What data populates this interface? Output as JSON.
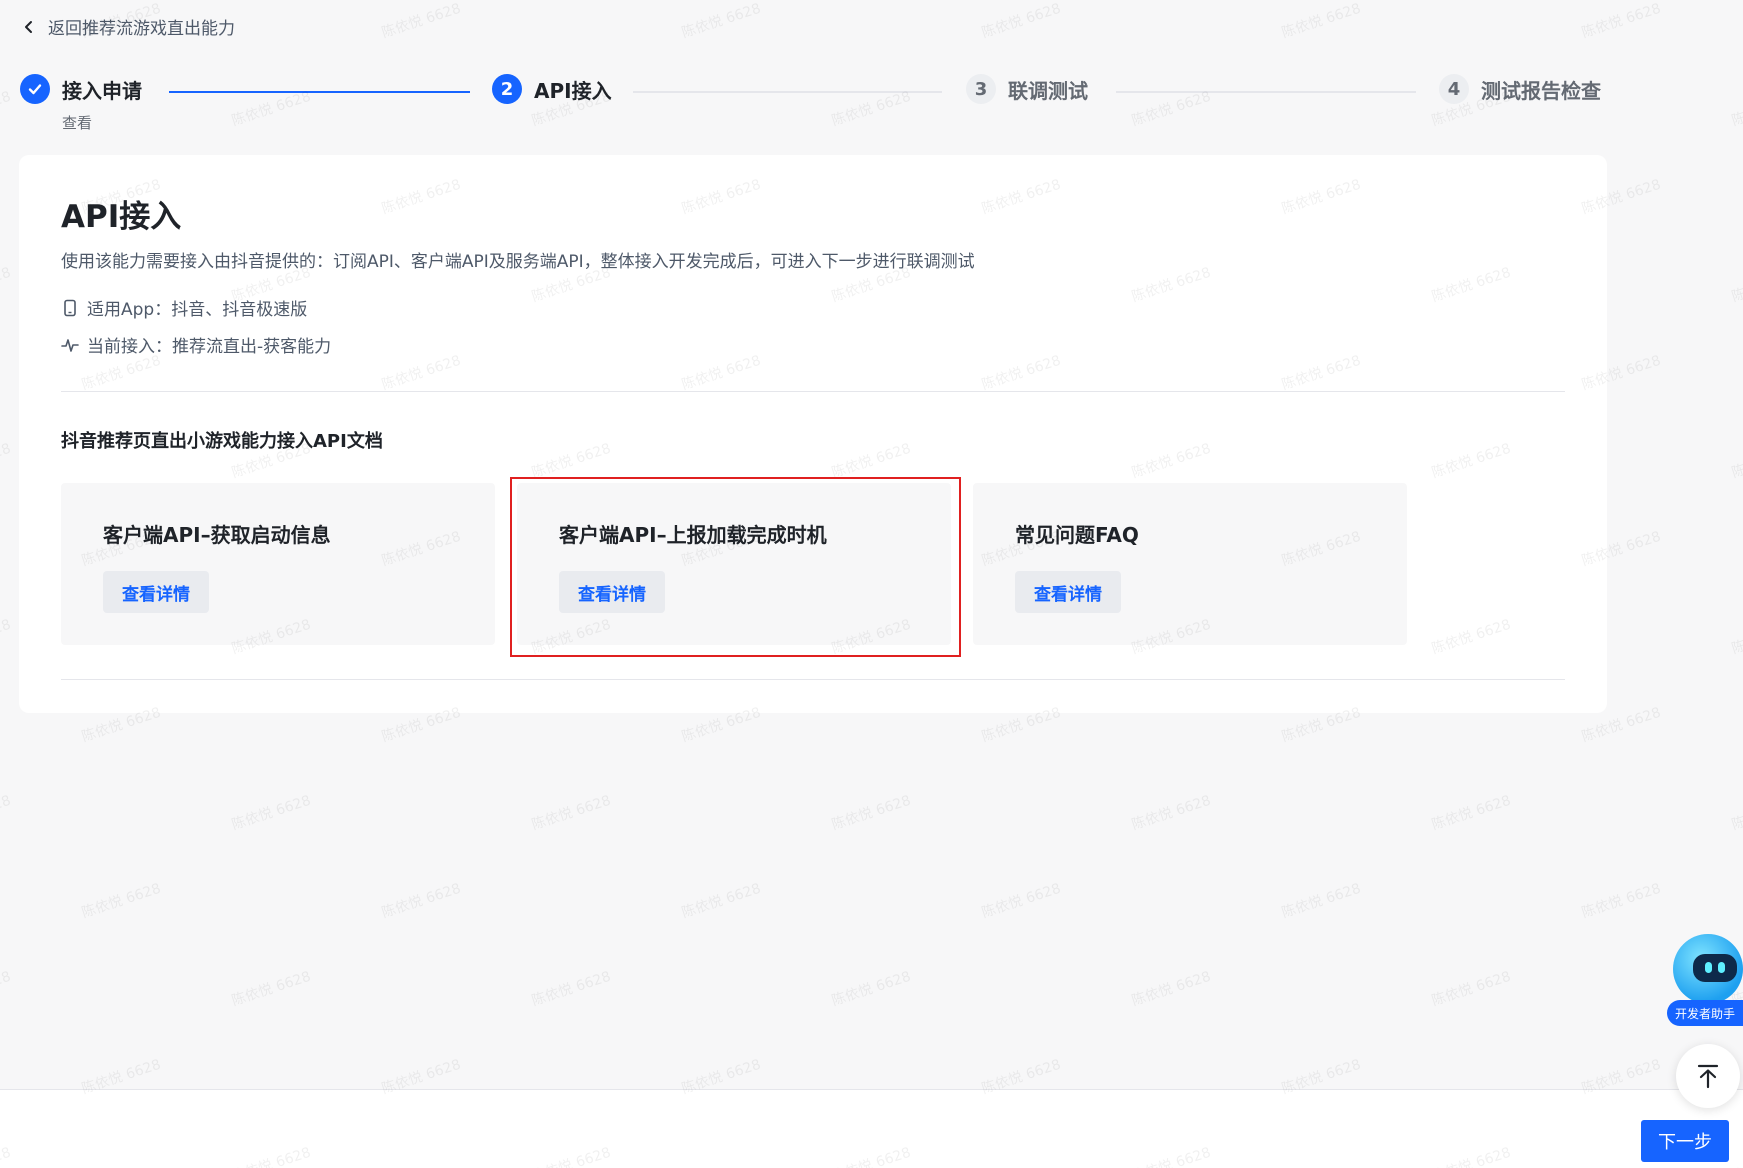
{
  "back": {
    "label": "返回推荐流游戏直出能力"
  },
  "steps": [
    {
      "number": "",
      "label": "接入申请",
      "sub": "查看",
      "status": "done"
    },
    {
      "number": "2",
      "label": "API接入",
      "status": "active"
    },
    {
      "number": "3",
      "label": "联调测试",
      "status": "wait"
    },
    {
      "number": "4",
      "label": "测试报告检查",
      "status": "wait"
    }
  ],
  "main": {
    "title": "API接入",
    "description": "使用该能力需要接入由抖音提供的：订阅API、客户端API及服务端API，整体接入开发完成后，可进入下一步进行联调测试",
    "apps": "适用App：抖音、抖音极速版",
    "current": "当前接入：推荐流直出-获客能力",
    "section_title": "抖音推荐页直出小游戏能力接入API文档",
    "docs": [
      {
        "title": "客户端API–获取启动信息",
        "button": "查看详情"
      },
      {
        "title": "客户端API–上报加载完成时机",
        "button": "查看详情"
      },
      {
        "title": "常见问题FAQ",
        "button": "查看详情"
      }
    ]
  },
  "helper": {
    "label": "开发者助手"
  },
  "footer": {
    "next_label": "下一步"
  },
  "watermark": {
    "text": "陈依悦 6628"
  },
  "colors": {
    "primary": "#1664ff",
    "highlight": "#e02020",
    "background": "#f7f7f8"
  },
  "icons": {
    "back": "chevron-left-icon",
    "done": "check-icon",
    "apps": "phone-icon",
    "current": "pulse-icon",
    "top": "arrow-up-to-top-icon"
  }
}
